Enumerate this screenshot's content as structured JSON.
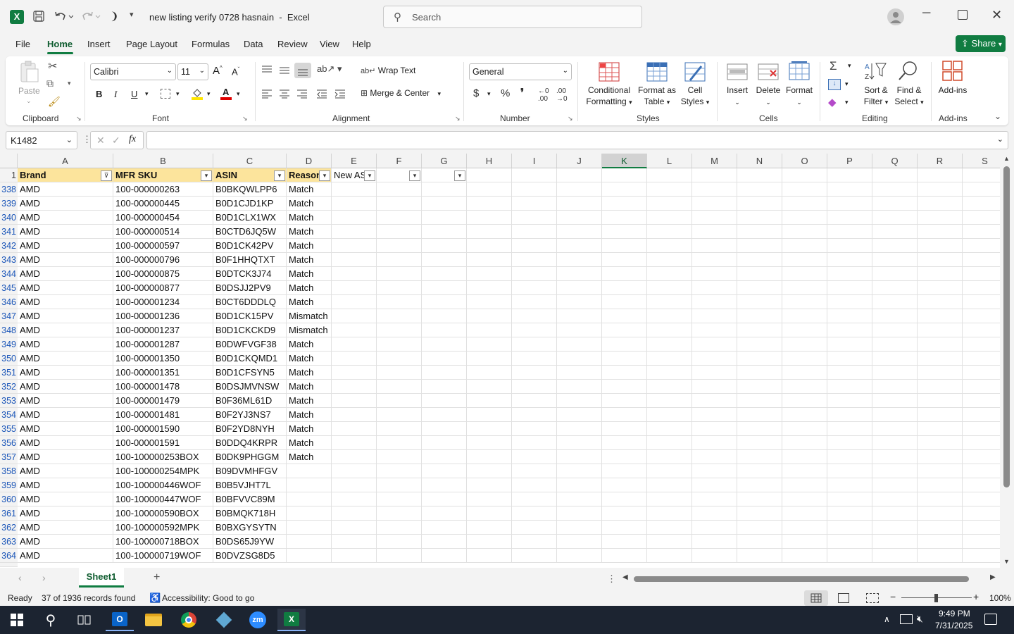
{
  "titlebar": {
    "file_name": "new listing verify 0728 hasnain",
    "app": "Excel",
    "search_placeholder": "Search"
  },
  "menu": [
    "File",
    "Home",
    "Insert",
    "Page Layout",
    "Formulas",
    "Data",
    "Review",
    "View",
    "Help"
  ],
  "share_label": "Share",
  "ribbon": {
    "clipboard": {
      "paste": "Paste",
      "label": "Clipboard"
    },
    "font": {
      "name": "Calibri",
      "size": "11",
      "label": "Font"
    },
    "alignment": {
      "wrap": "Wrap Text",
      "merge": "Merge & Center",
      "label": "Alignment"
    },
    "number": {
      "format": "General",
      "label": "Number"
    },
    "styles": {
      "conditional": "Conditional",
      "formatting": "Formatting",
      "format_as": "Format as",
      "table": "Table",
      "cell": "Cell",
      "cell_styles": "Styles",
      "label": "Styles"
    },
    "cells": {
      "insert": "Insert",
      "delete": "Delete",
      "format": "Format",
      "label": "Cells"
    },
    "editing": {
      "sort": "Sort &",
      "filter": "Filter",
      "find": "Find &",
      "select": "Select",
      "label": "Editing"
    },
    "addins": {
      "btn": "Add-ins",
      "label": "Add-ins"
    }
  },
  "formula_bar": {
    "name_box": "K1482",
    "formula": ""
  },
  "columns": [
    "A",
    "B",
    "C",
    "D",
    "E",
    "F",
    "G",
    "H",
    "I",
    "J",
    "K",
    "L",
    "M",
    "N",
    "O",
    "P",
    "Q",
    "R",
    "S"
  ],
  "header_row": {
    "num": "1",
    "brand": "Brand",
    "sku": "MFR SKU",
    "asin": "ASIN",
    "reason": "Reason",
    "new": "New AS"
  },
  "rows": [
    {
      "n": "338",
      "brand": "AMD",
      "sku": "100-000000263",
      "asin": "B0BKQWLPP6",
      "reason": "Match"
    },
    {
      "n": "339",
      "brand": "AMD",
      "sku": "100-000000445",
      "asin": "B0D1CJD1KP",
      "reason": "Match"
    },
    {
      "n": "340",
      "brand": "AMD",
      "sku": "100-000000454",
      "asin": "B0D1CLX1WX",
      "reason": "Match"
    },
    {
      "n": "341",
      "brand": "AMD",
      "sku": "100-000000514",
      "asin": "B0CTD6JQ5W",
      "reason": "Match"
    },
    {
      "n": "342",
      "brand": "AMD",
      "sku": "100-000000597",
      "asin": "B0D1CK42PV",
      "reason": "Match"
    },
    {
      "n": "343",
      "brand": "AMD",
      "sku": "100-000000796",
      "asin": "B0F1HHQTXT",
      "reason": "Match"
    },
    {
      "n": "344",
      "brand": "AMD",
      "sku": "100-000000875",
      "asin": "B0DTCK3J74",
      "reason": "Match"
    },
    {
      "n": "345",
      "brand": "AMD",
      "sku": "100-000000877",
      "asin": "B0DSJJ2PV9",
      "reason": "Match"
    },
    {
      "n": "346",
      "brand": "AMD",
      "sku": "100-000001234",
      "asin": "B0CT6DDDLQ",
      "reason": "Match"
    },
    {
      "n": "347",
      "brand": "AMD",
      "sku": "100-000001236",
      "asin": "B0D1CK15PV",
      "reason": "Mismatch"
    },
    {
      "n": "348",
      "brand": "AMD",
      "sku": "100-000001237",
      "asin": "B0D1CKCKD9",
      "reason": "Mismatch"
    },
    {
      "n": "349",
      "brand": "AMD",
      "sku": "100-000001287",
      "asin": "B0DWFVGF38",
      "reason": "Match"
    },
    {
      "n": "350",
      "brand": "AMD",
      "sku": "100-000001350",
      "asin": "B0D1CKQMD1",
      "reason": "Match"
    },
    {
      "n": "351",
      "brand": "AMD",
      "sku": "100-000001351",
      "asin": "B0D1CFSYN5",
      "reason": "Match"
    },
    {
      "n": "352",
      "brand": "AMD",
      "sku": "100-000001478",
      "asin": "B0DSJMVNSW",
      "reason": "Match"
    },
    {
      "n": "353",
      "brand": "AMD",
      "sku": "100-000001479",
      "asin": "B0F36ML61D",
      "reason": "Match"
    },
    {
      "n": "354",
      "brand": "AMD",
      "sku": "100-000001481",
      "asin": "B0F2YJ3NS7",
      "reason": "Match"
    },
    {
      "n": "355",
      "brand": "AMD",
      "sku": "100-000001590",
      "asin": "B0F2YD8NYH",
      "reason": "Match"
    },
    {
      "n": "356",
      "brand": "AMD",
      "sku": "100-000001591",
      "asin": "B0DDQ4KRPR",
      "reason": "Match"
    },
    {
      "n": "357",
      "brand": "AMD",
      "sku": "100-100000253BOX",
      "asin": "B0DK9PHGGM",
      "reason": "Match"
    },
    {
      "n": "358",
      "brand": "AMD",
      "sku": "100-100000254MPK",
      "asin": "B09DVMHFGV",
      "reason": ""
    },
    {
      "n": "359",
      "brand": "AMD",
      "sku": "100-100000446WOF",
      "asin": "B0B5VJHT7L",
      "reason": ""
    },
    {
      "n": "360",
      "brand": "AMD",
      "sku": "100-100000447WOF",
      "asin": "B0BFVVC89M",
      "reason": ""
    },
    {
      "n": "361",
      "brand": "AMD",
      "sku": "100-100000590BOX",
      "asin": "B0BMQK718H",
      "reason": ""
    },
    {
      "n": "362",
      "brand": "AMD",
      "sku": "100-100000592MPK",
      "asin": "B0BXGYSYTN",
      "reason": ""
    },
    {
      "n": "363",
      "brand": "AMD",
      "sku": "100-100000718BOX",
      "asin": "B0DS65J9YW",
      "reason": ""
    },
    {
      "n": "364",
      "brand": "AMD",
      "sku": "100-100000719WOF",
      "asin": "B0DVZSG8D5",
      "reason": ""
    }
  ],
  "sheet_tab": "Sheet1",
  "status": {
    "ready": "Ready",
    "records": "37 of 1936 records found",
    "accessibility": "Accessibility: Good to go",
    "zoom": "100%"
  },
  "clock": {
    "time": "9:49 PM",
    "date": "7/31/2025"
  },
  "colors": {
    "excel_green": "#107c41",
    "header_fill": "#fce49c",
    "row_num": "#1a55b8"
  }
}
